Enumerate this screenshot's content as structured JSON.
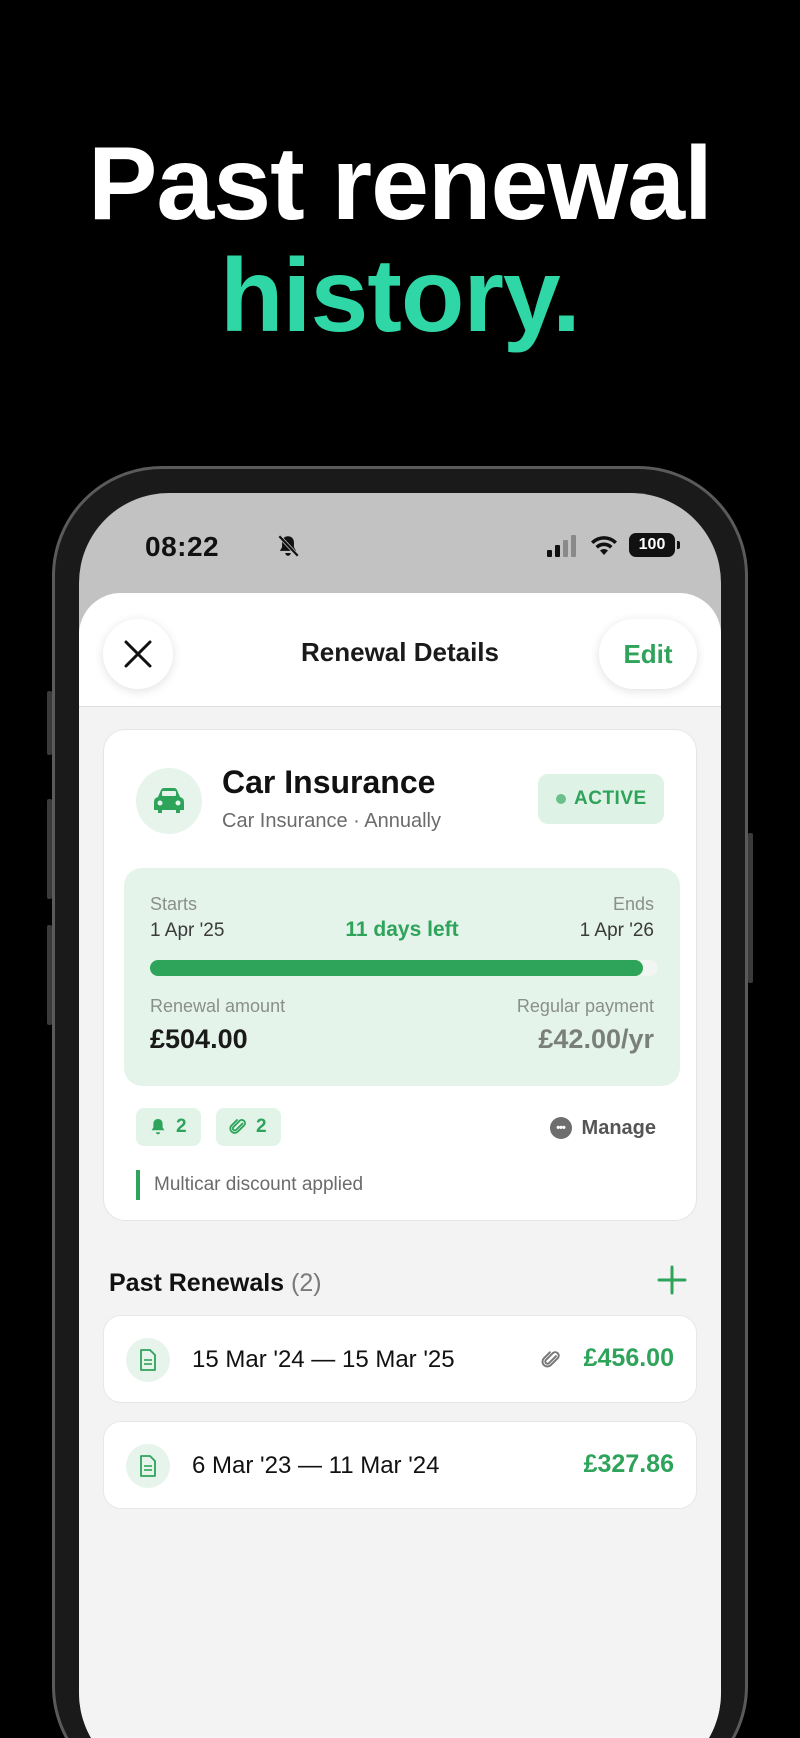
{
  "headline": {
    "line1": "Past renewal",
    "line2": "history."
  },
  "status_bar": {
    "time": "08:22",
    "battery": "100"
  },
  "nav": {
    "title": "Renewal Details",
    "edit_label": "Edit"
  },
  "policy": {
    "title": "Car Insurance",
    "subtitle": "Car Insurance · Annually",
    "status": "ACTIVE",
    "starts_label": "Starts",
    "starts_value": "1 Apr '25",
    "ends_label": "Ends",
    "ends_value": "1 Apr '26",
    "days_left": "11 days left",
    "progress_fraction": 0.97,
    "renewal_amount_label": "Renewal amount",
    "renewal_amount": "£504.00",
    "regular_payment_label": "Regular payment",
    "regular_payment": "£42.00/yr",
    "reminders_count": "2",
    "attachments_count": "2",
    "manage_label": "Manage",
    "note": "Multicar discount applied"
  },
  "past_renewals": {
    "title": "Past Renewals",
    "count": "(2)",
    "items": [
      {
        "period": "15 Mar '24 — 15 Mar '25",
        "amount": "£456.00",
        "has_attachment": true
      },
      {
        "period": "6 Mar '23 — 11 Mar '24",
        "amount": "£327.86",
        "has_attachment": false
      }
    ]
  },
  "colors": {
    "accent": "#2ea35a",
    "headline_accent": "#2fd6a6",
    "background": "#000000"
  },
  "icons": [
    "bell-off-icon",
    "signal-icon",
    "wifi-icon",
    "battery-icon",
    "close-icon",
    "car-icon",
    "bell-icon",
    "paperclip-icon",
    "more-icon",
    "plus-icon",
    "document-icon"
  ]
}
